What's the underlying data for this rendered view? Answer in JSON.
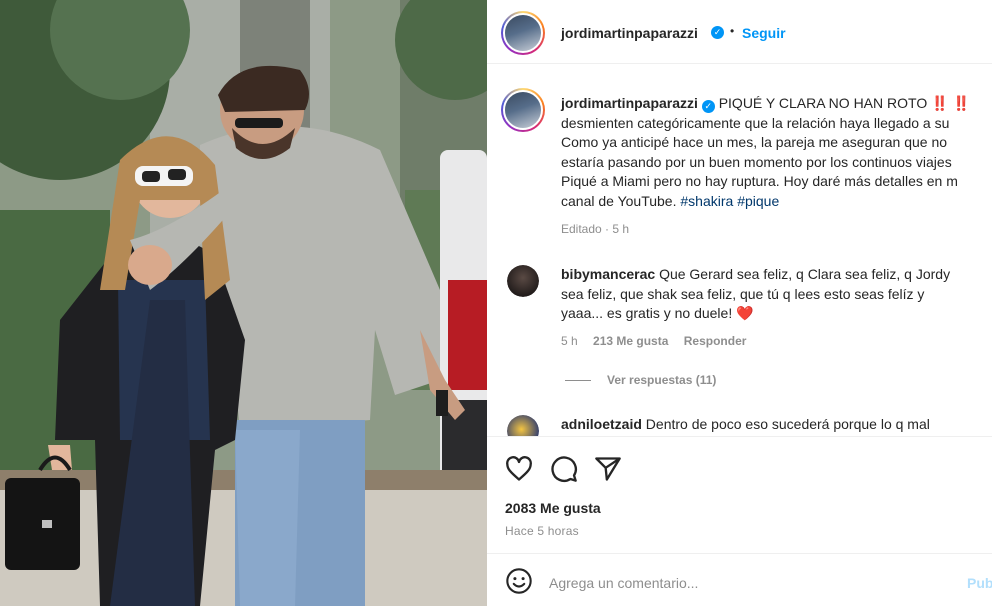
{
  "post": {
    "username": "jordimartinpaparazzi",
    "follow_label": "Seguir",
    "separator": "•",
    "verified_glyph": "✓"
  },
  "caption": {
    "username": "jordimartinpaparazzi",
    "text_1": "PIQUÉ Y CLARA NO HAN ROTO",
    "bang": "‼️",
    "line_2": "desmienten categóricamente que la relación haya llegado a su",
    "line_3": "Como ya anticipé hace un mes, la pareja me aseguran que no",
    "line_4": "estaría pasando por un buen momento por los continuos viajes",
    "line_5": "Piqué a Miami pero no hay ruptura. Hoy daré más detalles en m",
    "line_6_prefix": "canal de YouTube.",
    "hashtag_1": "#shakira",
    "hashtag_2": "#pique",
    "meta": "Editado · 5 h"
  },
  "comments": [
    {
      "username": "bibymancerac",
      "line_1": "Que Gerard sea feliz, q Clara sea feliz, q Jordy",
      "line_2": "sea feliz, que shak sea feliz, que tú q lees esto seas felíz y",
      "line_3": "yaaa... es gratis y no duele!",
      "emoji": "❤️",
      "time": "5 h",
      "likes": "213 Me gusta",
      "reply": "Responder",
      "view_replies": "Ver respuestas (11)"
    },
    {
      "username": "adniloetzaid",
      "line_1": "Dentro de poco eso sucederá porque lo q mal"
    }
  ],
  "actions": {
    "like_icon": "heart-icon",
    "comment_icon": "comment-icon",
    "share_icon": "share-icon",
    "likes_count": "2083 Me gusta",
    "posted": "Hace 5 horas"
  },
  "add_comment": {
    "emoji_icon": "emoji-icon",
    "placeholder": "Agrega un comentario...",
    "publish": "Publicar"
  },
  "colors": {
    "accent": "#0095f6",
    "hashtag": "#00376b",
    "muted": "#8e8e8e",
    "heart": "#e0245e"
  }
}
